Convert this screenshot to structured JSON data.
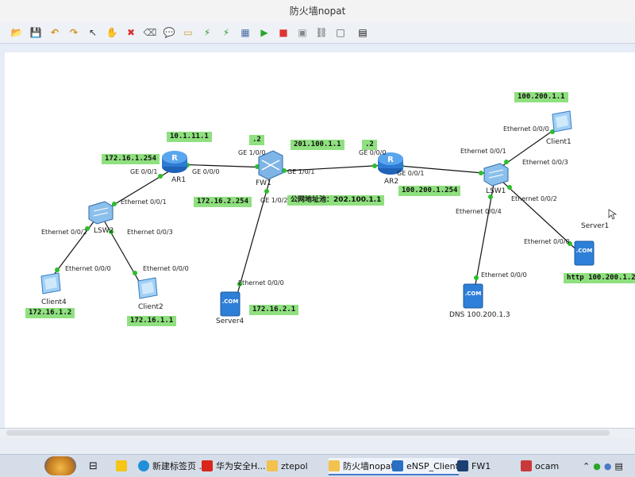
{
  "window": {
    "title": "防火墙nopat"
  },
  "toolbar": {
    "buttons": [
      {
        "name": "open-icon",
        "glyph": "📂"
      },
      {
        "name": "save-icon",
        "glyph": "💾"
      },
      {
        "name": "undo-icon",
        "glyph": "↶"
      },
      {
        "name": "redo-icon",
        "glyph": "↷"
      },
      {
        "name": "pointer-icon",
        "glyph": "↖"
      },
      {
        "name": "hand-icon",
        "glyph": "✋"
      },
      {
        "name": "delete-icon",
        "glyph": "✖"
      },
      {
        "name": "clear-icon",
        "glyph": "⌫"
      },
      {
        "name": "text-icon",
        "glyph": "💬"
      },
      {
        "name": "rect-icon",
        "glyph": "▭"
      },
      {
        "name": "capture-icon",
        "glyph": "⚡"
      },
      {
        "name": "capture2-icon",
        "glyph": "⚡"
      },
      {
        "name": "topology-icon",
        "glyph": "▦"
      },
      {
        "name": "start-icon",
        "glyph": "▶"
      },
      {
        "name": "stop-icon",
        "glyph": "■"
      },
      {
        "name": "grid-icon",
        "glyph": "▣"
      },
      {
        "name": "link-icon",
        "glyph": "⛓"
      },
      {
        "name": "frame-icon",
        "glyph": "□"
      },
      {
        "name": "console-icon",
        "glyph": "▤"
      }
    ]
  },
  "devices": {
    "ar1": "AR1",
    "ar2": "AR2",
    "fw1": "FW1",
    "lsw1": "LSW1",
    "lsw2": "LSW2",
    "client1": "Client1",
    "client2": "Client2",
    "client4": "Client4",
    "server1": "Server1",
    "server4": "Server4",
    "dns": "DNS 100.200.1.3"
  },
  "tags": {
    "t1": "100.200.1.1",
    "t2": "10.1.11.1",
    "t3": "172.16.1.254",
    "t4": ".2",
    "t5": "201.100.1.1",
    "t6": ".2",
    "t7": "100.200.1.254",
    "t8": "172.16.2.254",
    "t9": "公网地址池：202.100.1.1",
    "t10": "http 100.200.1.2",
    "t11": "172.16.1.2",
    "t12": "172.16.1.1",
    "t13": "172.16.2.1"
  },
  "ports": {
    "p1": "GE 0/0/1",
    "p2": "GE 0/0/0",
    "p3": "GE 1/0/0",
    "p4": "GE 1/0/1",
    "p5": "GE 1/0/2",
    "p6": "GE 0/0/0",
    "p7": "GE 0/0/1",
    "p8": "Ethernet 0/0/0",
    "p9": "Ethernet 0/0/1",
    "p10": "Ethernet 0/0/3",
    "p11": "Ethernet 0/0/2",
    "p12": "Ethernet 0/0/4",
    "p13": "Ethernet 0/0/0",
    "p14": "Ethernet 0/0/0",
    "p15": "Ethernet 0/0/1",
    "p16": "Ethernet 0/0/2",
    "p17": "Ethernet 0/0/3",
    "p18": "Ethernet 0/0/0",
    "p19": "Ethernet 0/0/0",
    "p20": "Ethernet 0/0/0"
  },
  "taskbar": {
    "items": [
      {
        "label": "新建标签页 ..."
      },
      {
        "label": "华为安全H..."
      },
      {
        "label": "ztepol"
      },
      {
        "label": "防火墙nopat"
      },
      {
        "label": "eNSP_Client"
      },
      {
        "label": "FW1"
      },
      {
        "label": "ocam"
      }
    ]
  },
  "colors": {
    "tag_bg": "#8fe07f",
    "link": "#111111",
    "port_dot": "#2bbf2b"
  }
}
